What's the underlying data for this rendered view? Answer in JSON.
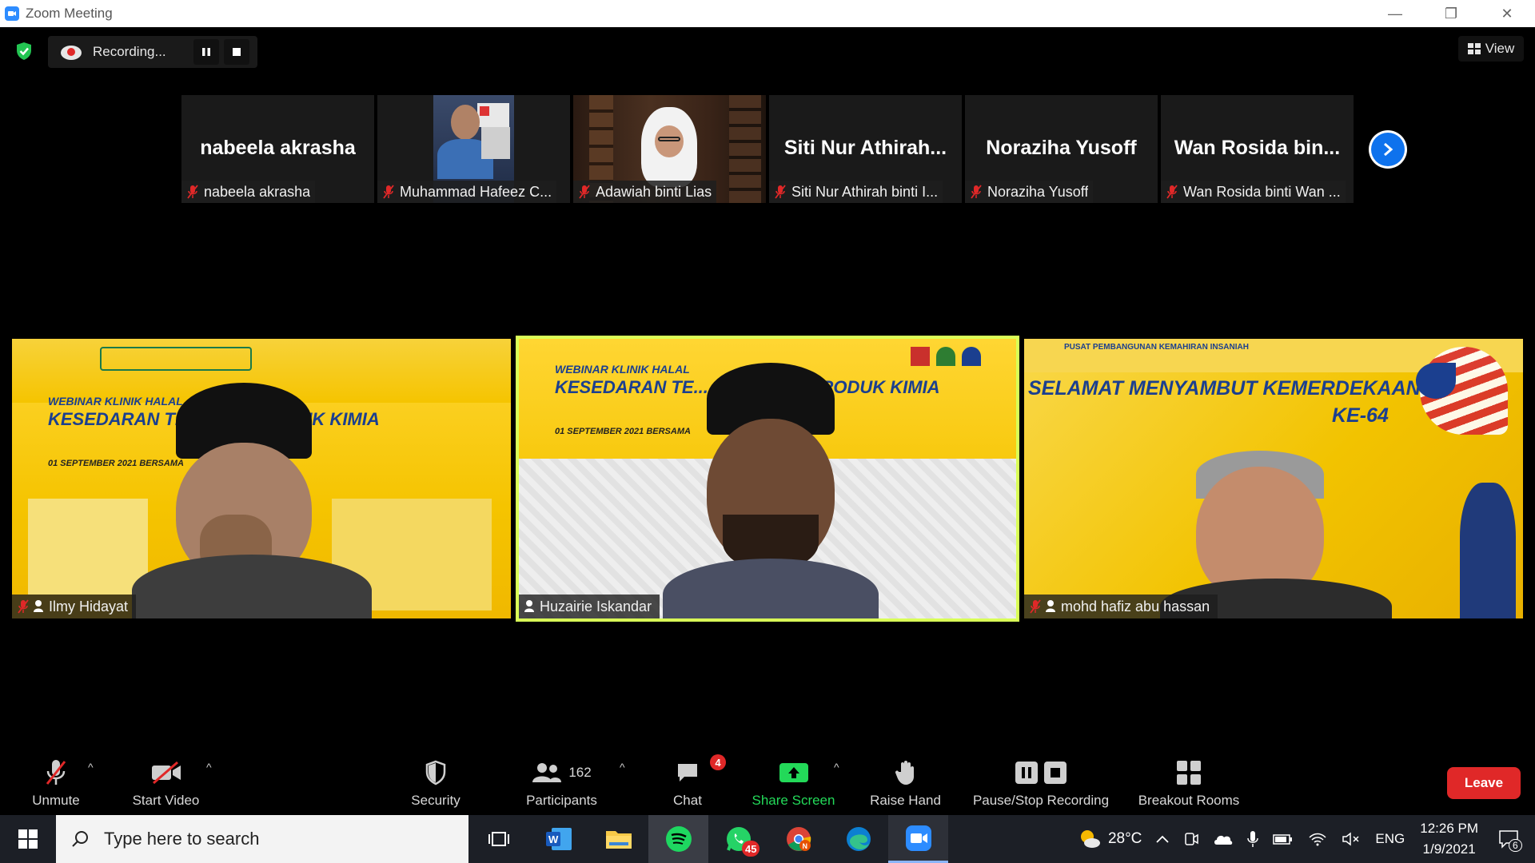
{
  "window": {
    "title": "Zoom Meeting"
  },
  "recording": {
    "status": "Recording..."
  },
  "view_button": {
    "label": "View"
  },
  "thumbnails": [
    {
      "big_label": "nabeela akrasha",
      "name": "nabeela akrasha",
      "video": false
    },
    {
      "big_label": "",
      "name": "Muhammad Hafeez C...",
      "video": true
    },
    {
      "big_label": "",
      "name": "Adawiah binti Lias",
      "video": true
    },
    {
      "big_label": "Siti Nur Athirah...",
      "name": "Siti Nur Athirah binti I...",
      "video": false
    },
    {
      "big_label": "Noraziha Yusoff",
      "name": "Noraziha Yusoff",
      "video": false
    },
    {
      "big_label": "Wan Rosida bin...",
      "name": "Wan Rosida binti Wan ...",
      "video": false
    }
  ],
  "tiles": [
    {
      "name": "Ilmy Hidayat",
      "banner_l1": "WEBINAR KLINIK HALAL",
      "banner_l2": "KESEDARAN TE... AAN PRODUK KIMIA",
      "banner_l3": "01 SEPTEMBER 2021 BERSAMA"
    },
    {
      "name": "Huzairie Iskandar",
      "banner_l1": "WEBINAR KLINIK HALAL",
      "banner_l2": "KESEDARAN TE...  GGUNAAN PRODUK KIMIA",
      "banner_l3": "01 SEPTEMBER 2021 BERSAMA"
    },
    {
      "name": "mohd hafiz abu hassan",
      "banner_l1": "PUSAT PEMBANGUNAN KEMAHIRAN INSANIAH",
      "banner_l2": "SELAMAT MENYAMBUT KEMERDEKAAN",
      "banner_l3": "KE-64"
    }
  ],
  "toolbar": {
    "unmute": "Unmute",
    "start_video": "Start Video",
    "security": "Security",
    "participants": "Participants",
    "participants_count": "162",
    "chat": "Chat",
    "chat_badge": "4",
    "share_screen": "Share Screen",
    "raise_hand": "Raise Hand",
    "pause_stop": "Pause/Stop Recording",
    "breakout": "Breakout Rooms",
    "leave": "Leave"
  },
  "taskbar": {
    "search_placeholder": "Type here to search",
    "whatsapp_badge": "45",
    "temperature": "28°C",
    "language": "ENG",
    "time": "12:26 PM",
    "date": "1/9/2021",
    "notifications": "6"
  },
  "colors": {
    "accent_blue": "#0e72ed",
    "leave_red": "#e02828",
    "share_green": "#23d959",
    "active_speaker": "#d9ff57"
  }
}
